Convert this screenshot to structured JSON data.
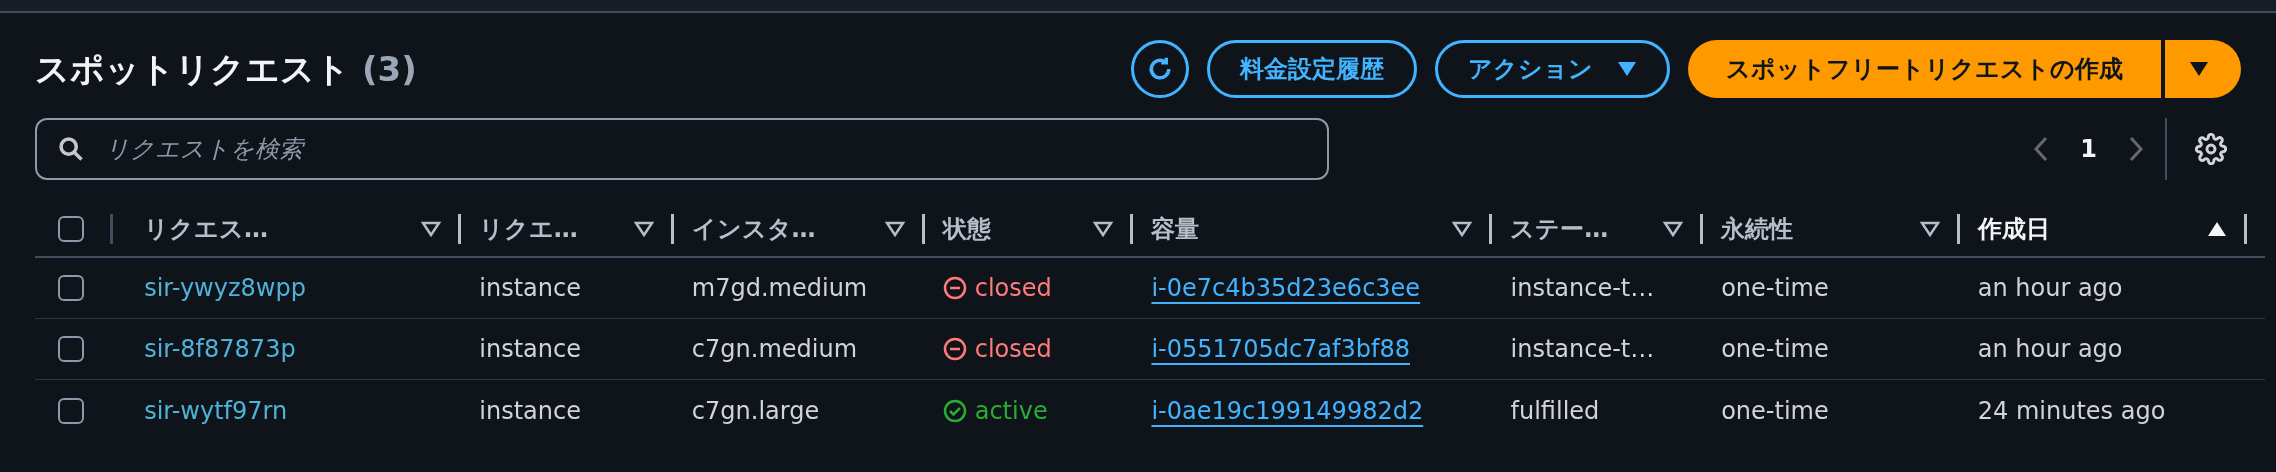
{
  "header": {
    "title": "スポットリクエスト",
    "count": "(3)"
  },
  "actions": {
    "buttons": [
      {
        "label": "料金設定履歴",
        "kind": "plain"
      },
      {
        "label": "アクション",
        "kind": "dropdown"
      }
    ],
    "primary": {
      "label": "スポットフリートリクエストの作成"
    }
  },
  "search": {
    "placeholder": "リクエストを検索"
  },
  "pagination": {
    "page": "1"
  },
  "table": {
    "select_all_checked": false,
    "columns": [
      {
        "label": "リクエス…",
        "sorted": false
      },
      {
        "label": "リクエ…",
        "sorted": false
      },
      {
        "label": "インスタ…",
        "sorted": false
      },
      {
        "label": "状態",
        "sorted": false
      },
      {
        "label": "容量",
        "sorted": false
      },
      {
        "label": "ステー…",
        "sorted": false
      },
      {
        "label": "永続性",
        "sorted": false
      },
      {
        "label": "作成日",
        "sorted": true
      }
    ],
    "rows": [
      {
        "checked": false,
        "id": "sir-ywyz8wpp",
        "type": "instance",
        "instance_type": "m7gd.medium",
        "state": {
          "kind": "closed",
          "label": "closed"
        },
        "capacity": "i-0e7c4b35d23e6c3ee",
        "status": "instance-t…",
        "persistence": "one-time",
        "created": "an hour ago"
      },
      {
        "checked": false,
        "id": "sir-8f87873p",
        "type": "instance",
        "instance_type": "c7gn.medium",
        "state": {
          "kind": "closed",
          "label": "closed"
        },
        "capacity": "i-0551705dc7af3bf88",
        "status": "instance-t…",
        "persistence": "one-time",
        "created": "an hour ago"
      },
      {
        "checked": false,
        "id": "sir-wytf97rn",
        "type": "instance",
        "instance_type": "c7gn.large",
        "state": {
          "kind": "active",
          "label": "active"
        },
        "capacity": "i-0ae19c199149982d2",
        "status": "fulfilled",
        "persistence": "one-time",
        "created": "24 minutes ago"
      }
    ]
  }
}
